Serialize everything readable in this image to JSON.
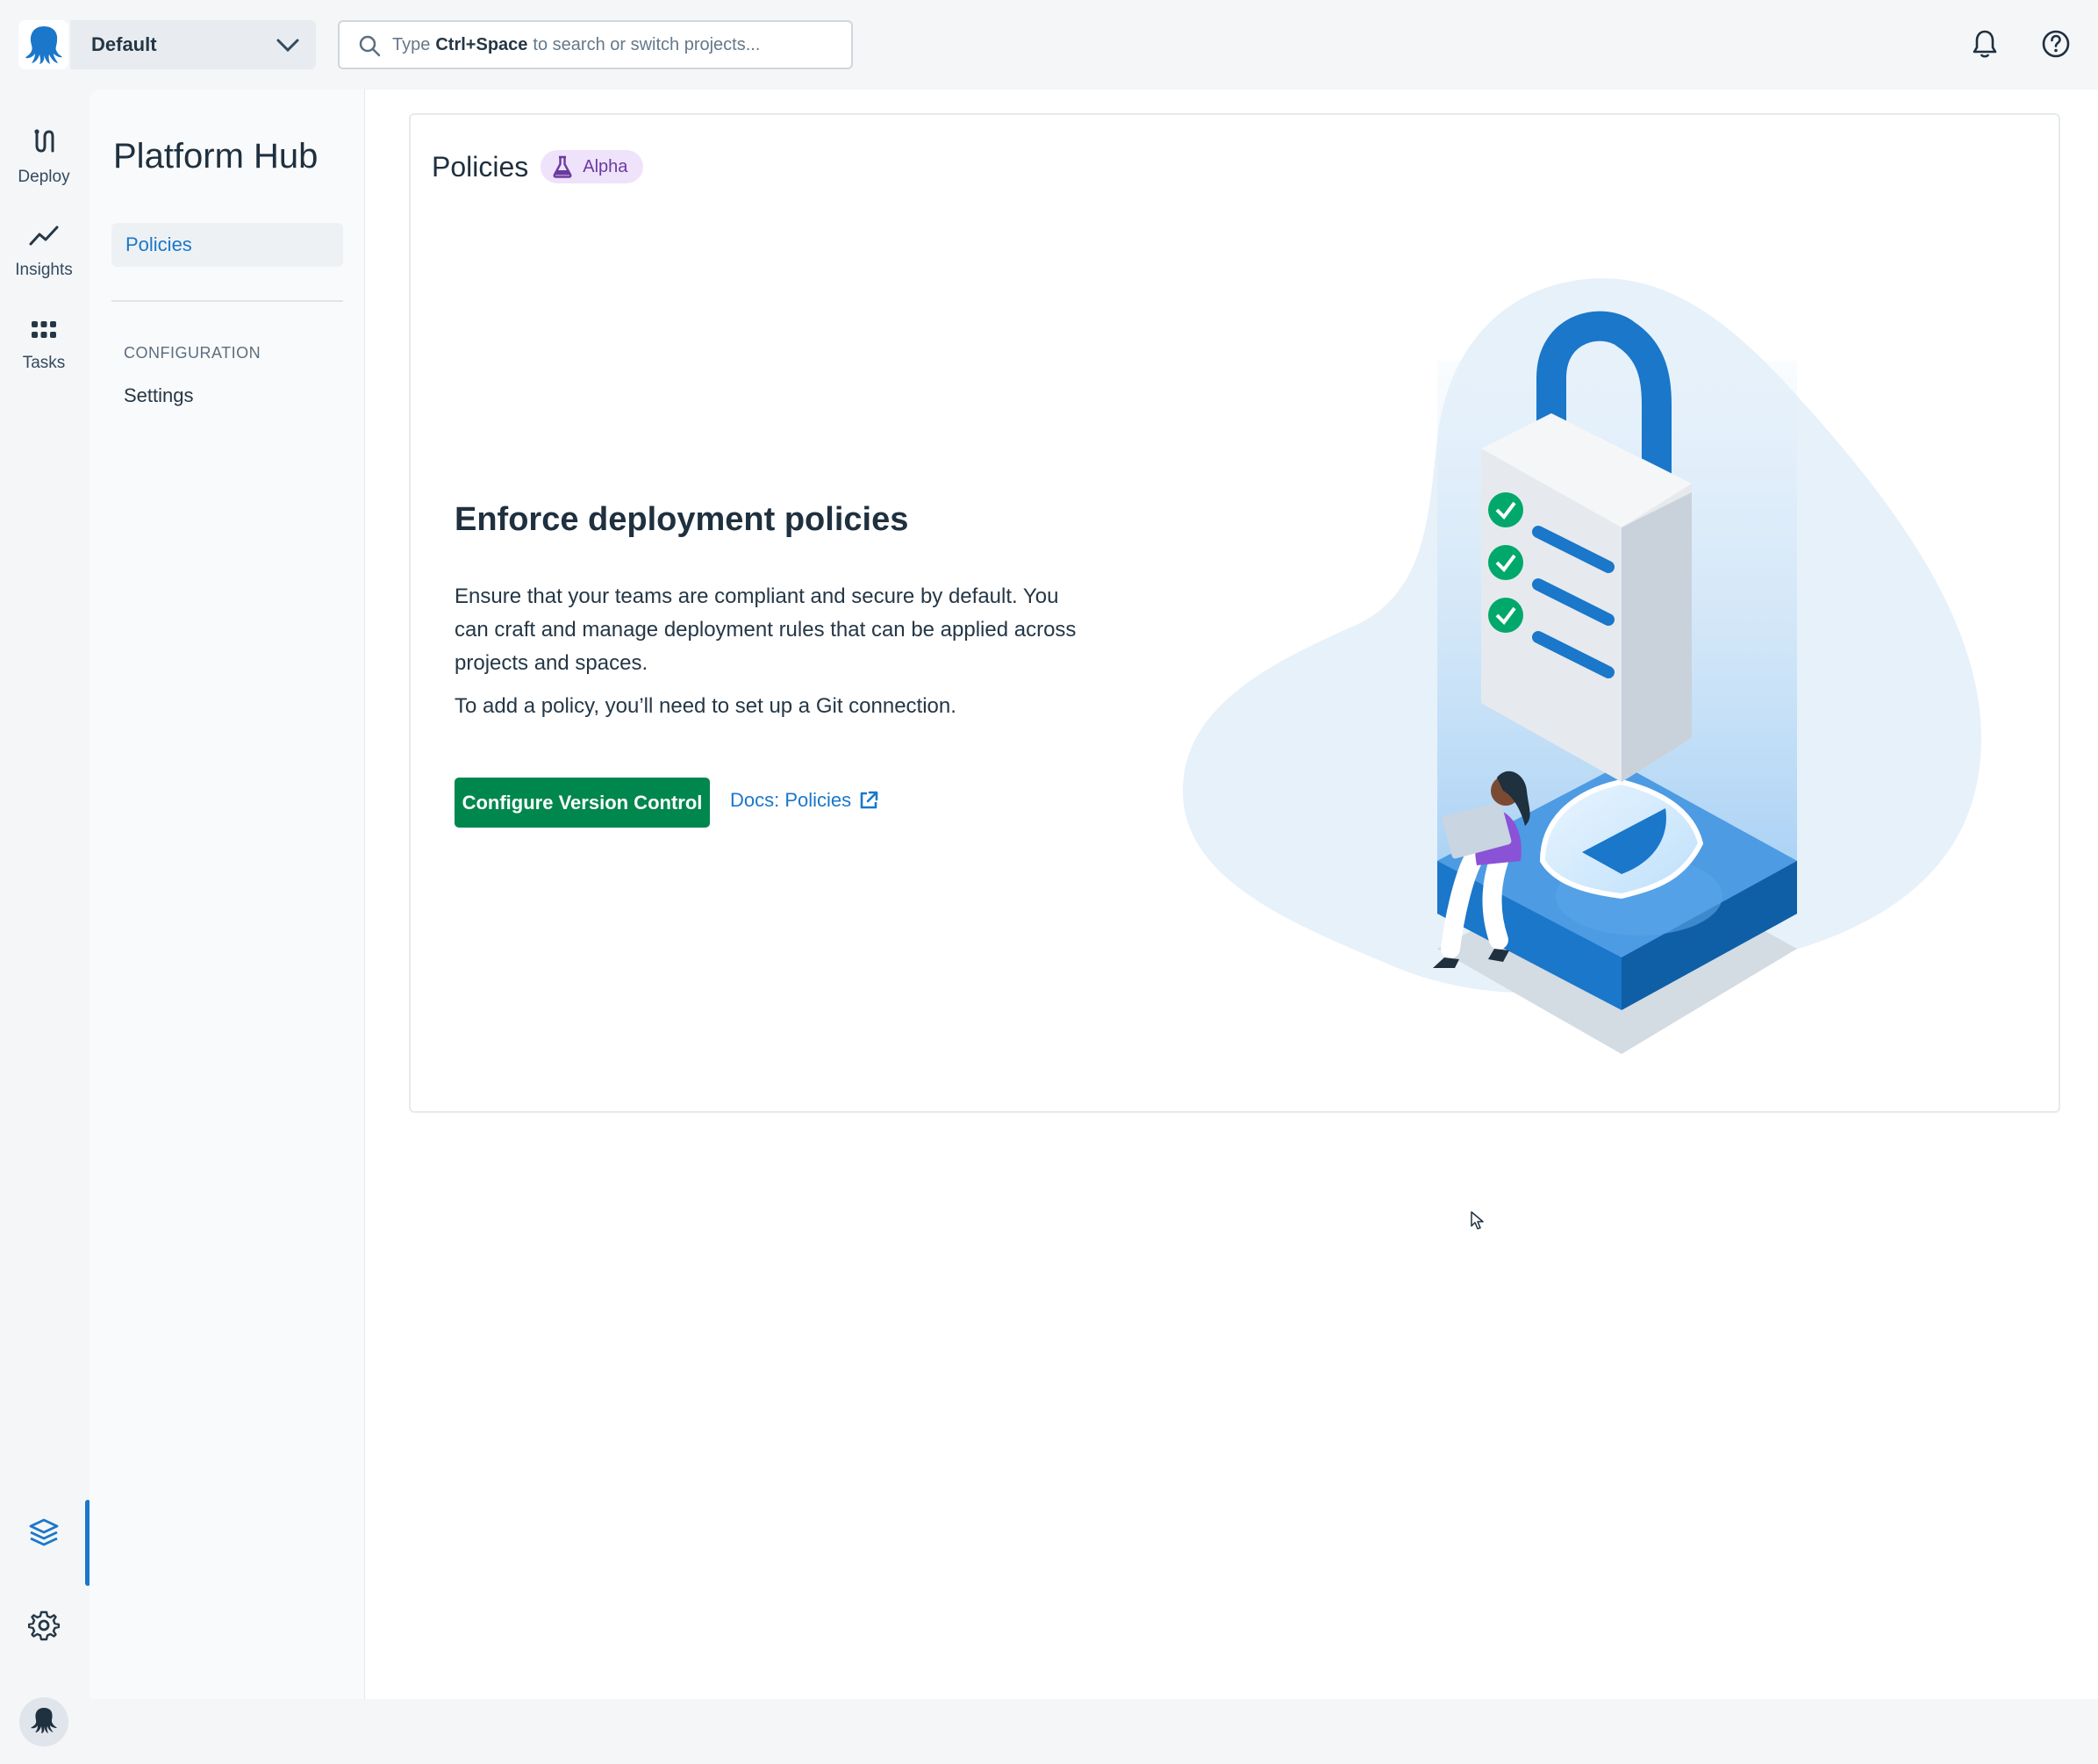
{
  "topbar": {
    "space_name": "Default",
    "search": {
      "prefix": "Type",
      "shortcut": "Ctrl+Space",
      "suffix": "to search or switch projects..."
    }
  },
  "rail": {
    "items": [
      {
        "label": "Deploy",
        "icon": "deploy-icon"
      },
      {
        "label": "Insights",
        "icon": "insights-icon"
      },
      {
        "label": "Tasks",
        "icon": "tasks-icon"
      }
    ],
    "bottom_icons": [
      "platform-hub-icon",
      "gear-icon",
      "avatar"
    ]
  },
  "sidebar": {
    "title": "Platform Hub",
    "active_item": "Policies",
    "section_label": "CONFIGURATION",
    "items": [
      "Settings"
    ]
  },
  "main": {
    "header_title": "Policies",
    "badge": "Alpha",
    "hero_title": "Enforce deployment policies",
    "hero_paragraph": "Ensure that your teams are compliant and secure by default. You can craft and manage deployment rules that can be applied across projects and spaces.",
    "hero_note": "To add a policy, you’ll need to set up a Git connection.",
    "primary_button": "Configure Version Control",
    "docs_link": "Docs: Policies"
  },
  "colors": {
    "accent": "#1a77ca",
    "primary_button": "#00874d",
    "badge_bg": "#efe2fb",
    "badge_text": "#6a3aa0"
  }
}
